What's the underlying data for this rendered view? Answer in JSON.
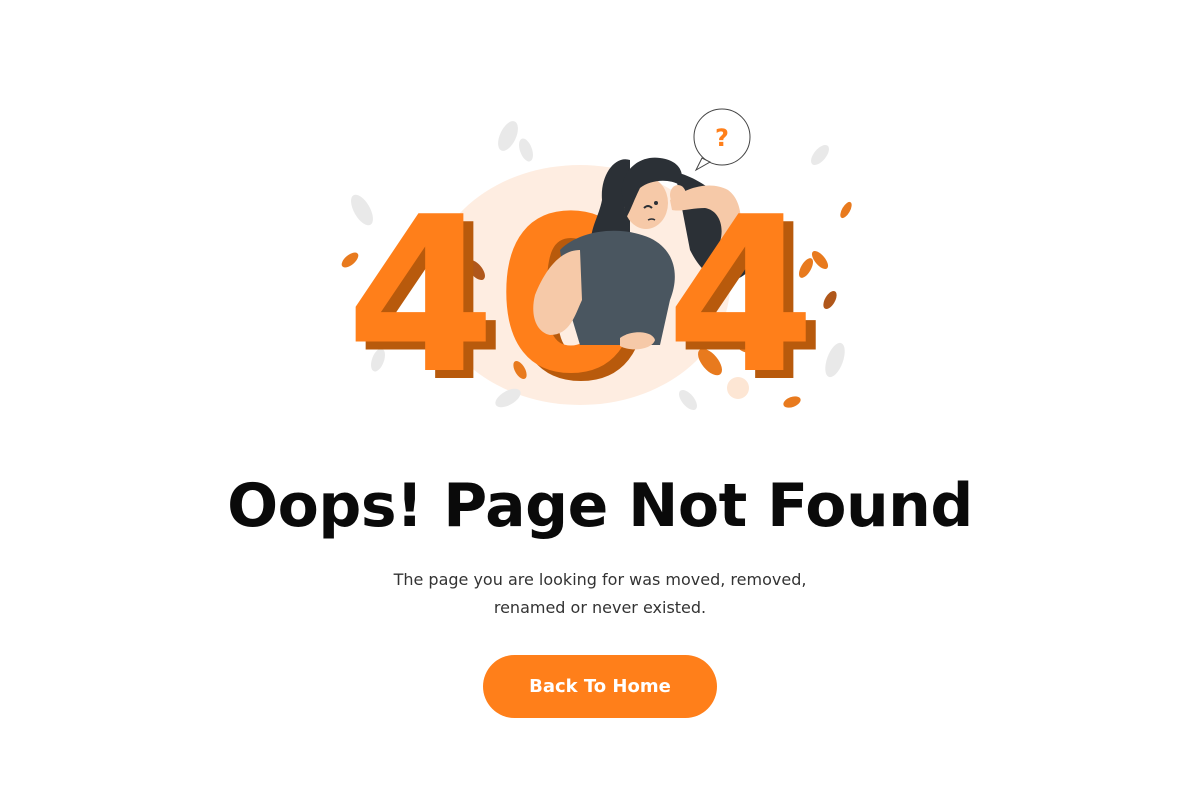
{
  "illustration": {
    "code": "404",
    "question_mark": "?",
    "colors": {
      "primary": "#ff7f1a",
      "shade": "#b85a0c",
      "blob": "#fde6d4",
      "shirt": "#4a5660",
      "hair": "#2b3036",
      "skin": "#f6c9a8"
    }
  },
  "error": {
    "title": "Oops! Page Not Found",
    "message_line1": "The page you are looking for was moved, removed,",
    "message_line2": "renamed or never existed."
  },
  "actions": {
    "back_home_label": "Back To Home",
    "button_color": "#ff7f1a"
  }
}
